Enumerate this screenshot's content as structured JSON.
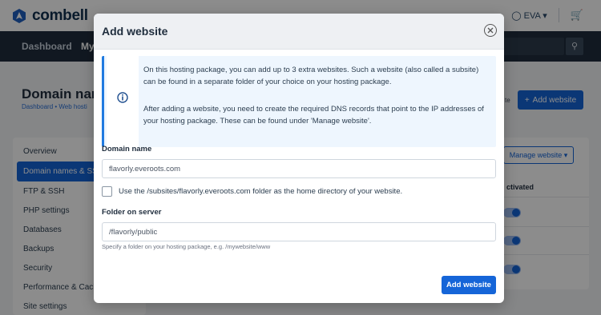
{
  "topbar": {
    "brand": "combell",
    "menu_items": [
      "",
      "",
      "EVA"
    ],
    "cart_icon": "cart-icon"
  },
  "navbar": {
    "items": [
      "Dashboard",
      "My"
    ],
    "search_icon": "search-icon"
  },
  "page": {
    "title": "Domain nam",
    "breadcrumb": "Dashboard  •  Web hosti",
    "add_button": "Add website",
    "right_small": "te"
  },
  "sidebar": {
    "items": [
      {
        "label": "Overview"
      },
      {
        "label": "Domain names & SS",
        "active": true
      },
      {
        "label": "FTP & SSH"
      },
      {
        "label": "PHP settings"
      },
      {
        "label": "Databases"
      },
      {
        "label": "Backups"
      },
      {
        "label": "Security"
      },
      {
        "label": "Performance & Cachi"
      },
      {
        "label": "Site settings"
      }
    ]
  },
  "table": {
    "manage_button": "Manage website",
    "column_activated": "ctivated"
  },
  "modal": {
    "title": "Add website",
    "info": {
      "paragraph1": "On this hosting package, you can add up to 3 extra websites. Such a website (also called a subsite) can be found in a separate folder of your choice on your hosting package.",
      "paragraph2": "After adding a website, you need to create the required DNS records that point to the IP addresses of your hosting package. These can be found under 'Manage website'."
    },
    "domain_label": "Domain name",
    "domain_value": "flavorly.everoots.com",
    "checkbox_label": "Use the /subsites/flavorly.everoots.com folder as the home directory of your website.",
    "folder_label": "Folder on server",
    "folder_value": "/flavorly/public",
    "helper_text": "Specify a folder on your hosting package, e.g. /mywebsite/www",
    "submit_label": "Add website"
  },
  "colors": {
    "primary": "#1565d8",
    "navbar_bg": "#1f2d3d",
    "info_bg": "#eef6fe"
  }
}
